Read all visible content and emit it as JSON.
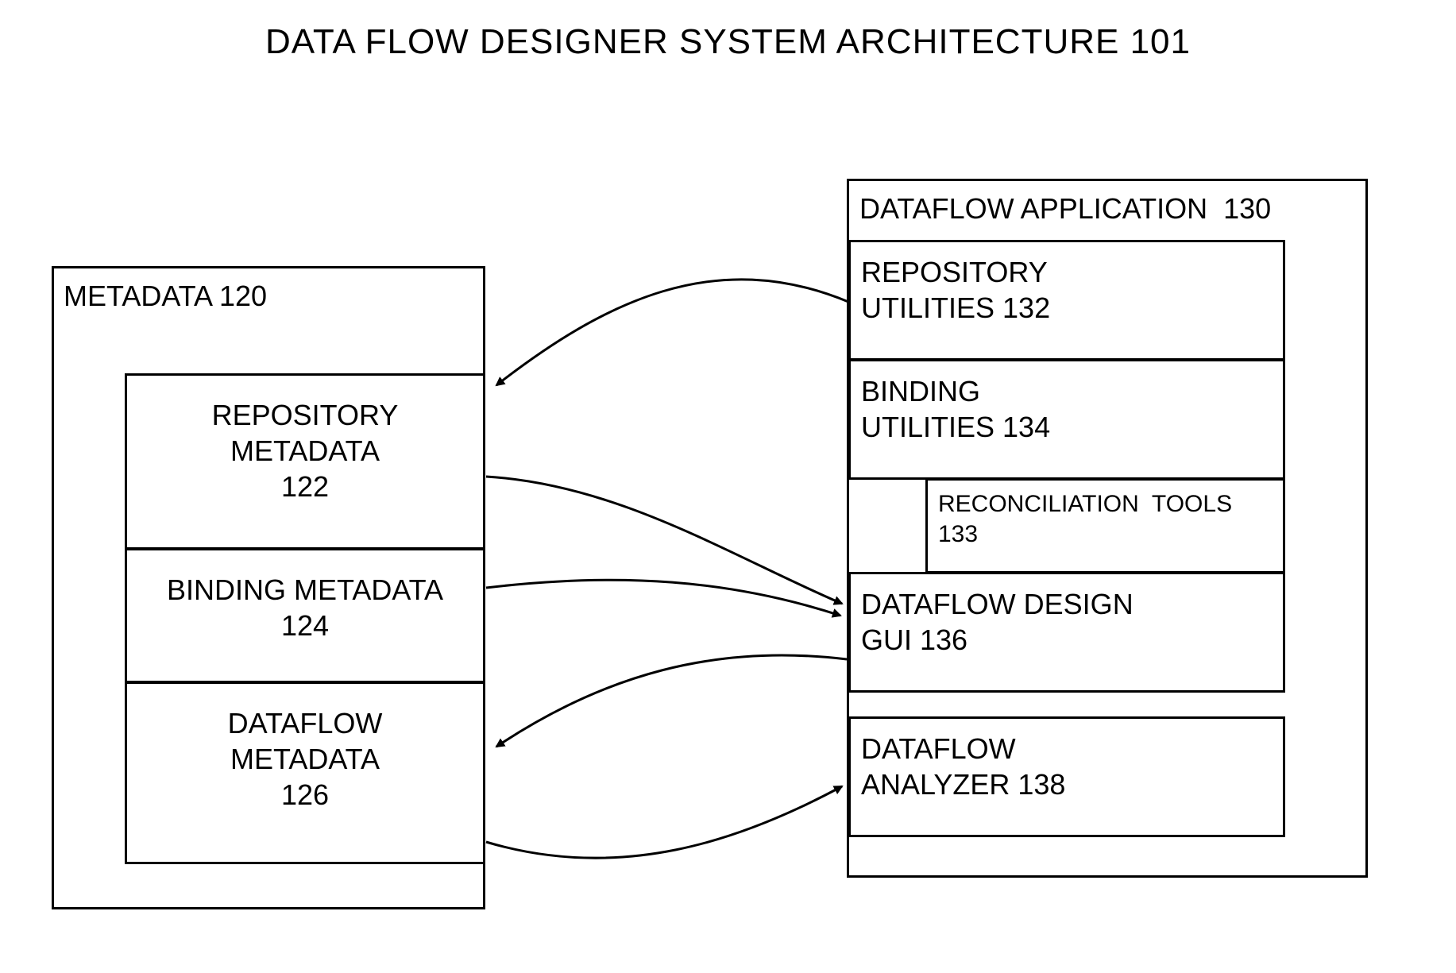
{
  "title": "DATA FLOW DESIGNER  SYSTEM ARCHITECTURE 101",
  "metadata": {
    "header": "METADATA 120",
    "repository": "REPOSITORY\nMETADATA\n122",
    "binding": "BINDING METADATA\n124",
    "dataflow": "DATAFLOW\nMETADATA\n126"
  },
  "application": {
    "header": "DATAFLOW APPLICATION  130",
    "repository_utilities": "REPOSITORY\nUTILITIES 132",
    "binding_utilities": "BINDING\nUTILITIES 134",
    "reconciliation_tools": "RECONCILIATION  TOOLS\n133",
    "design_gui": "DATAFLOW DESIGN\nGUI 136",
    "analyzer": "DATAFLOW\nANALYZER 138"
  }
}
